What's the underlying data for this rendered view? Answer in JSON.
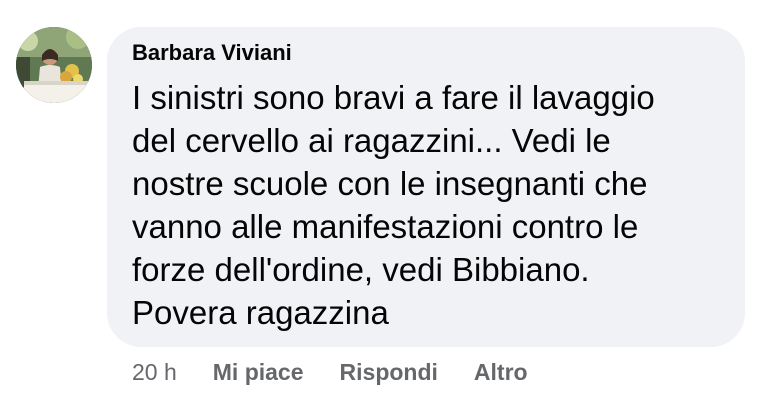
{
  "comment": {
    "author": "Barbara Viviani",
    "lines": [
      "I sinistri sono bravi a fare il lavaggio",
      "del cervello ai ragazzini... Vedi le",
      "nostre scuole con le insegnanti che",
      "vanno alle manifestazioni contro le",
      "forze dell'ordine, vedi Bibbiano.",
      "Povera ragazzina"
    ],
    "timestamp": "20 h",
    "actions": {
      "like": "Mi piace",
      "reply": "Rispondi",
      "more": "Altro"
    }
  },
  "colors": {
    "bubble": "#f0f2f5",
    "text": "#050505",
    "secondary": "#65676b"
  }
}
